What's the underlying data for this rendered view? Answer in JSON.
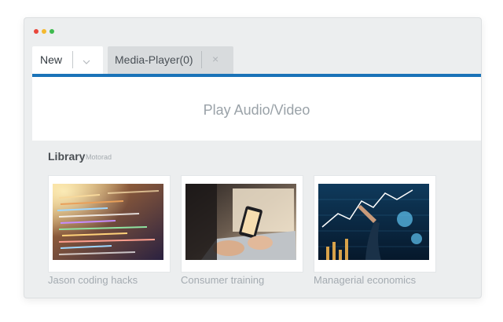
{
  "window": {
    "controls": [
      {
        "name": "close",
        "color": "#e9473b"
      },
      {
        "name": "minimize",
        "color": "#f4b92f"
      },
      {
        "name": "maximize",
        "color": "#3fba4f"
      }
    ]
  },
  "tabs": {
    "new_label": "New",
    "media_label": "Media-Player(0)",
    "close_glyph": "×"
  },
  "player": {
    "title": "Play Audio/Video"
  },
  "library": {
    "title": "Library",
    "subtitle": "Motorad",
    "items": [
      {
        "caption": "Jason coding hacks",
        "thumb": "code-screen"
      },
      {
        "caption": "Consumer training",
        "thumb": "laptop-phone"
      },
      {
        "caption": "Managerial economics",
        "thumb": "data-chart"
      }
    ]
  },
  "colors": {
    "accent": "#1a73b8"
  }
}
